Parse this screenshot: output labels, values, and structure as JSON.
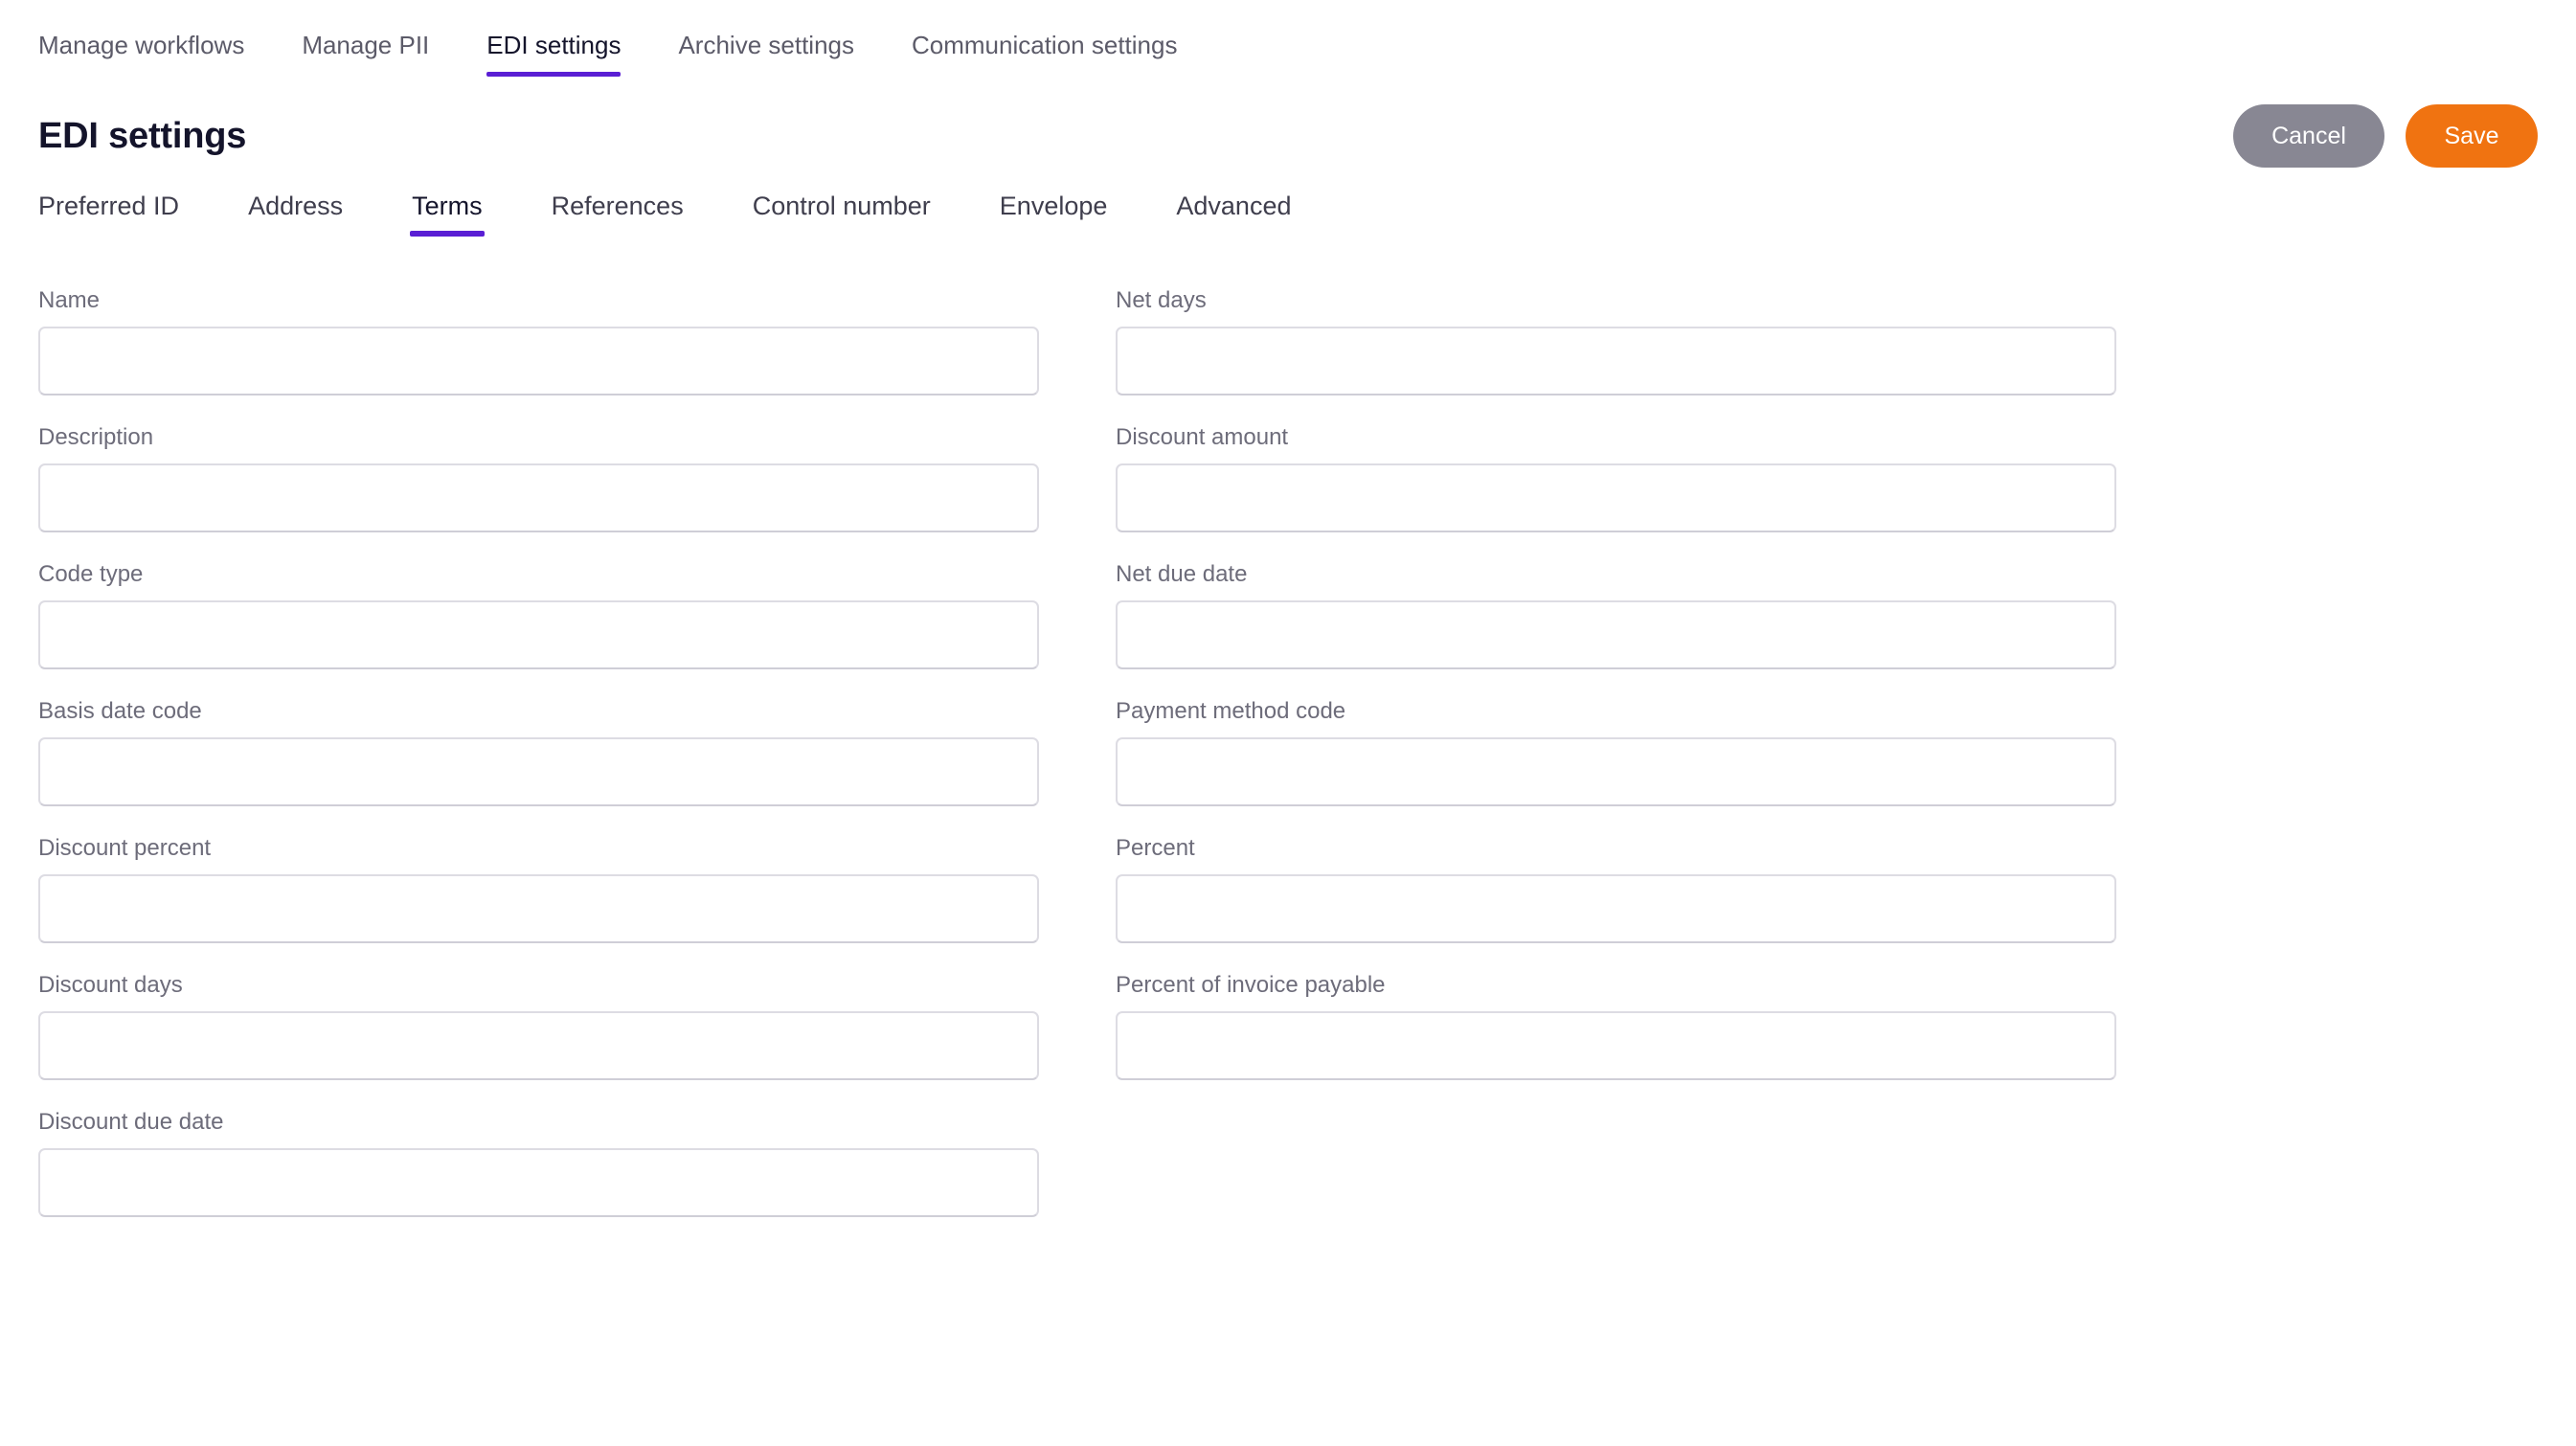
{
  "top_nav": {
    "items": [
      {
        "label": "Manage workflows",
        "active": false
      },
      {
        "label": "Manage PII",
        "active": false
      },
      {
        "label": "EDI settings",
        "active": true
      },
      {
        "label": "Archive settings",
        "active": false
      },
      {
        "label": "Communication settings",
        "active": false
      }
    ]
  },
  "header": {
    "title": "EDI settings",
    "cancel_label": "Cancel",
    "save_label": "Save",
    "cancel_color": "#888793",
    "save_color": "#f07311"
  },
  "sub_nav": {
    "active_color": "#5a1fd4",
    "items": [
      {
        "label": "Preferred ID",
        "active": false
      },
      {
        "label": "Address",
        "active": false
      },
      {
        "label": "Terms",
        "active": true
      },
      {
        "label": "References",
        "active": false
      },
      {
        "label": "Control number",
        "active": false
      },
      {
        "label": "Envelope",
        "active": false
      },
      {
        "label": "Advanced",
        "active": false
      }
    ]
  },
  "form": {
    "left_fields": [
      {
        "label": "Name",
        "value": "",
        "placeholder": ""
      },
      {
        "label": "Description",
        "value": "",
        "placeholder": ""
      },
      {
        "label": "Code type",
        "value": "",
        "placeholder": ""
      },
      {
        "label": "Basis date code",
        "value": "",
        "placeholder": ""
      },
      {
        "label": "Discount percent",
        "value": "",
        "placeholder": ""
      },
      {
        "label": "Discount days",
        "value": "",
        "placeholder": ""
      },
      {
        "label": "Discount due date",
        "value": "",
        "placeholder": ""
      }
    ],
    "right_fields": [
      {
        "label": "Net days",
        "value": "",
        "placeholder": ""
      },
      {
        "label": "Discount amount",
        "value": "",
        "placeholder": ""
      },
      {
        "label": "Net due date",
        "value": "",
        "placeholder": ""
      },
      {
        "label": "Payment method code",
        "value": "",
        "placeholder": ""
      },
      {
        "label": "Percent",
        "value": "",
        "placeholder": ""
      },
      {
        "label": "Percent of invoice payable",
        "value": "",
        "placeholder": ""
      }
    ]
  }
}
